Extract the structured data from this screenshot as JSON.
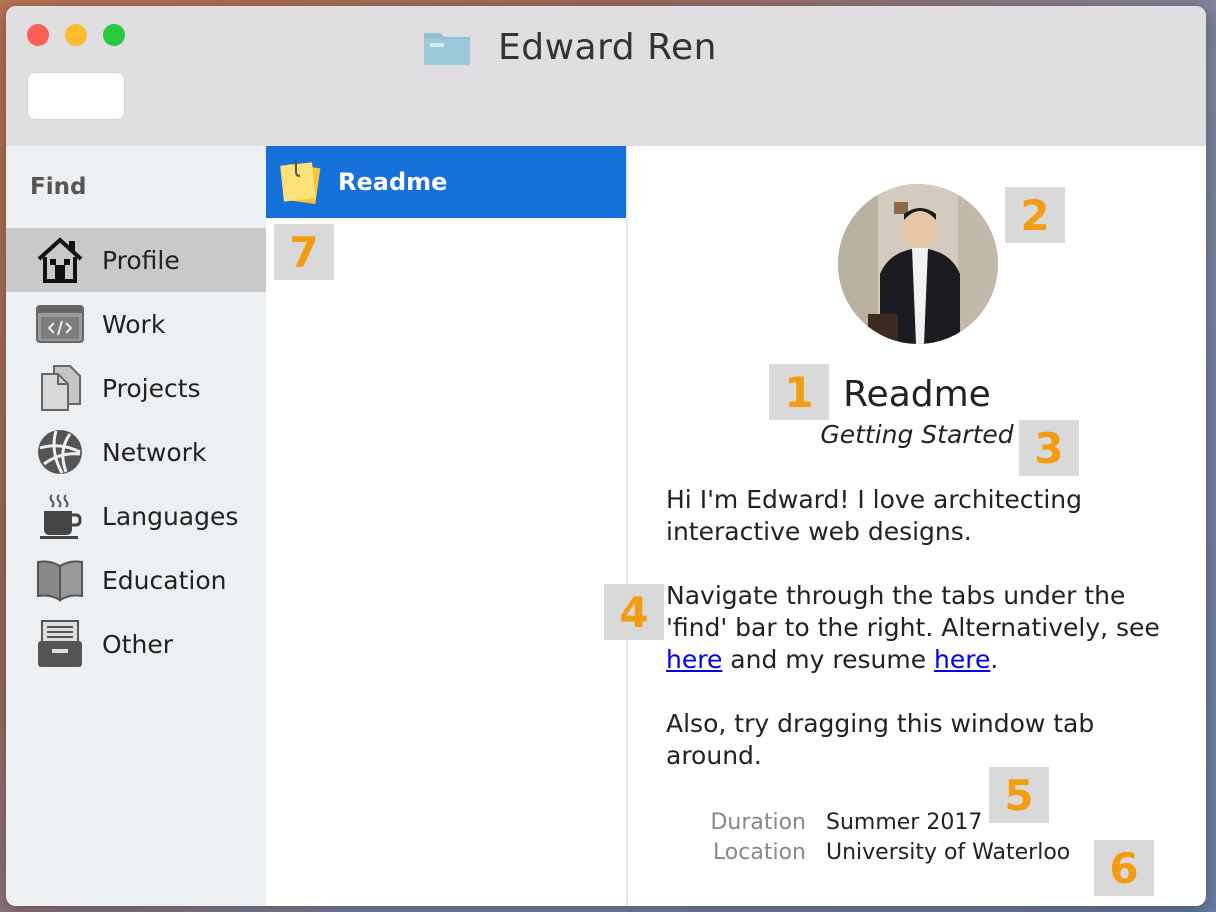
{
  "window": {
    "title": "Edward Ren"
  },
  "sidebar": {
    "heading": "Find",
    "items": [
      {
        "label": "Profile",
        "icon": "home-icon"
      },
      {
        "label": "Work",
        "icon": "code-window-icon"
      },
      {
        "label": "Projects",
        "icon": "documents-icon"
      },
      {
        "label": "Network",
        "icon": "globe-icon"
      },
      {
        "label": "Languages",
        "icon": "coffee-cup-icon"
      },
      {
        "label": "Education",
        "icon": "open-book-icon"
      },
      {
        "label": "Other",
        "icon": "filing-drawer-icon"
      }
    ],
    "active_index": 0
  },
  "filelist": {
    "items": [
      {
        "label": "Readme",
        "icon": "sticky-notes-icon",
        "selected": true
      }
    ]
  },
  "detail": {
    "title": "Readme",
    "subtitle": "Getting Started",
    "intro": "Hi I'm Edward! I love architecting interactive web designs.",
    "nav_text_1": "Navigate through the tabs under the 'find' bar to the right. Alternatively, see",
    "link_1": "here",
    "nav_text_2": "and my resume",
    "link_2": "here",
    "nav_text_3": ".",
    "drag_text": "Also, try dragging this window tab around.",
    "meta": [
      {
        "key": "Duration",
        "value": "Summer 2017"
      },
      {
        "key": "Location",
        "value": "University of Waterloo"
      }
    ]
  },
  "annotations": {
    "b1": "1",
    "b2": "2",
    "b3": "3",
    "b4": "4",
    "b5": "5",
    "b6": "6",
    "b7": "7"
  },
  "colors": {
    "selection_blue": "#1570d9",
    "badge_orange": "#f39c12",
    "sidebar_bg": "#edf0f2",
    "titlebar_bg": "#e0dee0"
  }
}
